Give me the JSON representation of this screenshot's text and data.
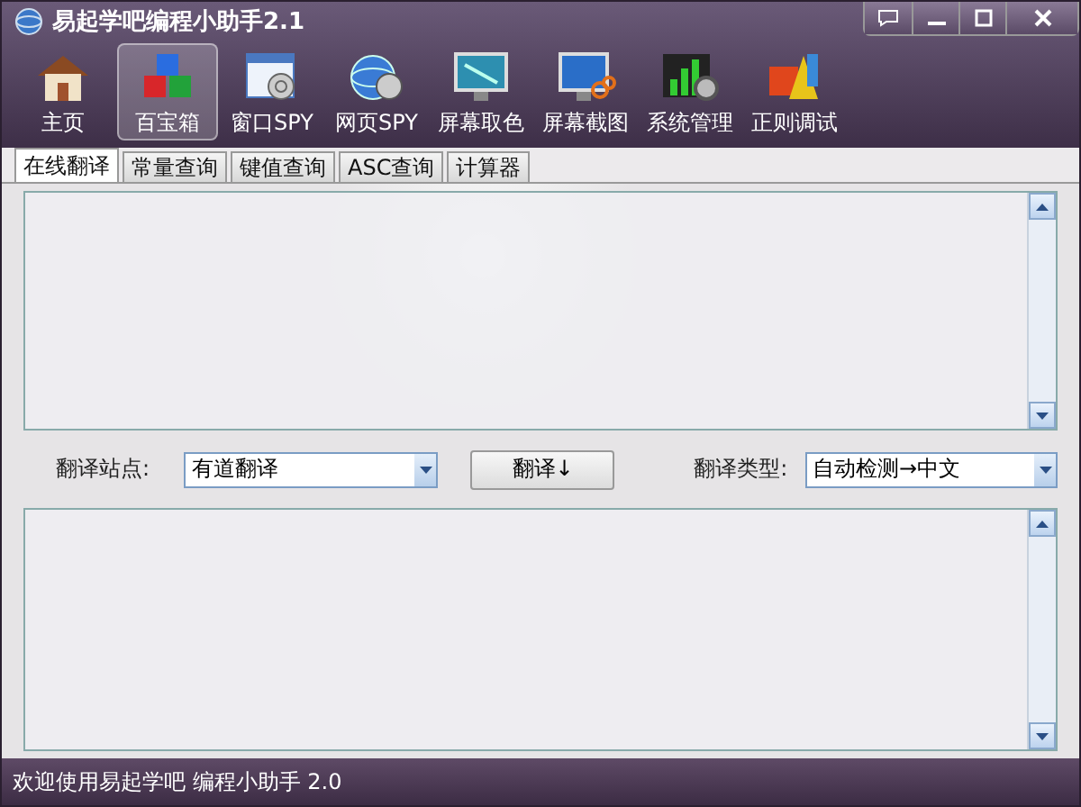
{
  "window": {
    "title": "易起学吧编程小助手2.1"
  },
  "toolbar": [
    {
      "label": "主页",
      "selected": false
    },
    {
      "label": "百宝箱",
      "selected": true
    },
    {
      "label": "窗口SPY",
      "selected": false
    },
    {
      "label": "网页SPY",
      "selected": false
    },
    {
      "label": "屏幕取色",
      "selected": false
    },
    {
      "label": "屏幕截图",
      "selected": false
    },
    {
      "label": "系统管理",
      "selected": false
    },
    {
      "label": "正则调试",
      "selected": false
    }
  ],
  "tabs": [
    {
      "label": "在线翻译",
      "selected": true
    },
    {
      "label": "常量查询",
      "selected": false
    },
    {
      "label": "键值查询",
      "selected": false
    },
    {
      "label": "ASC查询",
      "selected": false
    },
    {
      "label": "计算器",
      "selected": false
    }
  ],
  "translate": {
    "site_label": "翻译站点:",
    "site_value": "有道翻译",
    "button": "翻译↓",
    "type_label": "翻译类型:",
    "type_value": "自动检测→中文"
  },
  "status_bar": "欢迎使用易起学吧 编程小助手 2.0"
}
